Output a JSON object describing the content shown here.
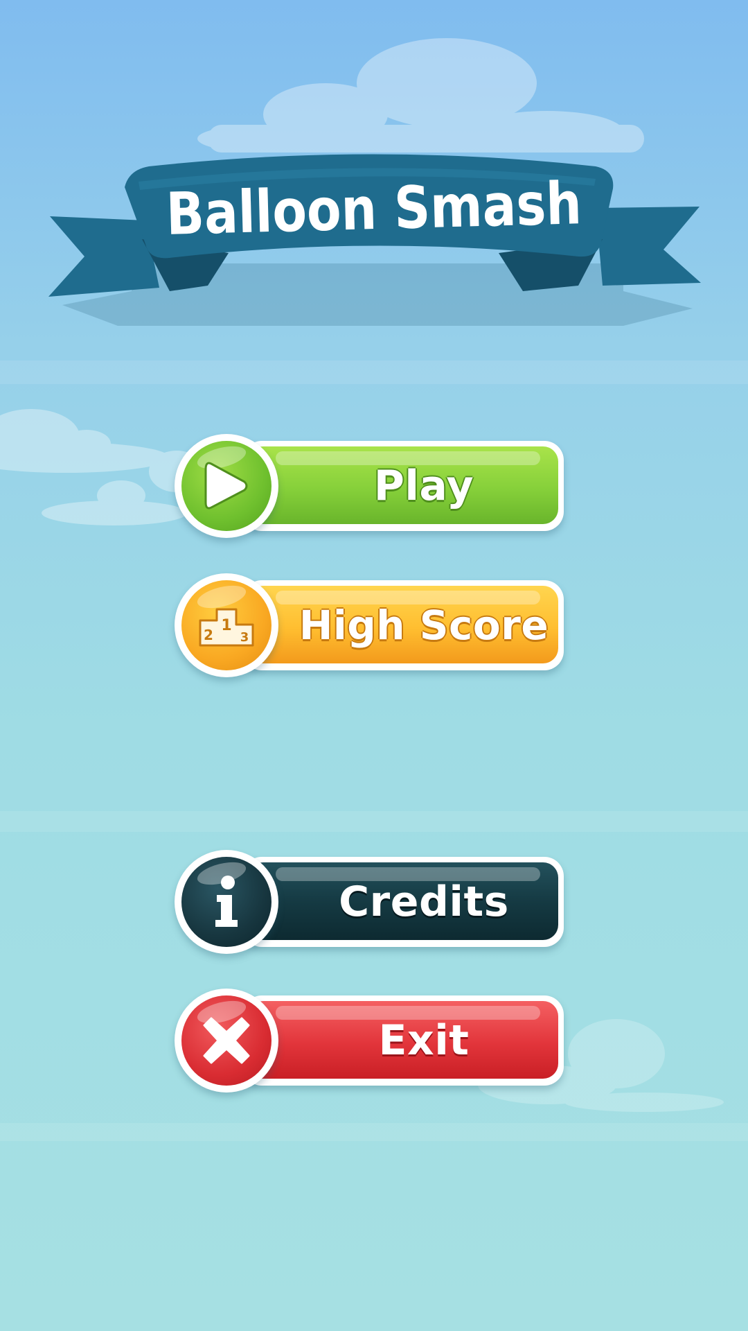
{
  "game": {
    "title": "Balloon Smash"
  },
  "menu": {
    "play_label": "Play",
    "highscore_label": "High Score",
    "credits_label": "Credits",
    "exit_label": "Exit"
  },
  "podium_icon": {
    "first": "1",
    "second": "2",
    "third": "3"
  },
  "icons": {
    "play": "play-triangle-icon",
    "highscore": "podium-icon",
    "credits": "info-icon",
    "exit": "close-x-icon"
  },
  "colors": {
    "sky_top": "#80bcef",
    "sky_bottom": "#a6e0e3",
    "ribbon": "#1f6c8e",
    "play": "#86d03a",
    "highscore": "#ffbe30",
    "credits": "#153a43",
    "exit": "#e2353b"
  }
}
